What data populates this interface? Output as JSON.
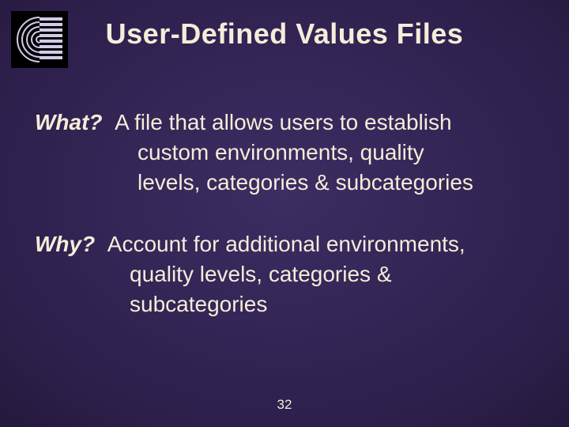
{
  "title": "User-Defined Values Files",
  "what": {
    "label": "What?",
    "line1": "A file that allows users to establish",
    "line2": "custom environments, quality",
    "line3": "levels, categories & subcategories"
  },
  "why": {
    "label": "Why?",
    "line1": "Account for additional environments,",
    "line2": "quality levels, categories &",
    "line3": "subcategories"
  },
  "page_number": "32"
}
